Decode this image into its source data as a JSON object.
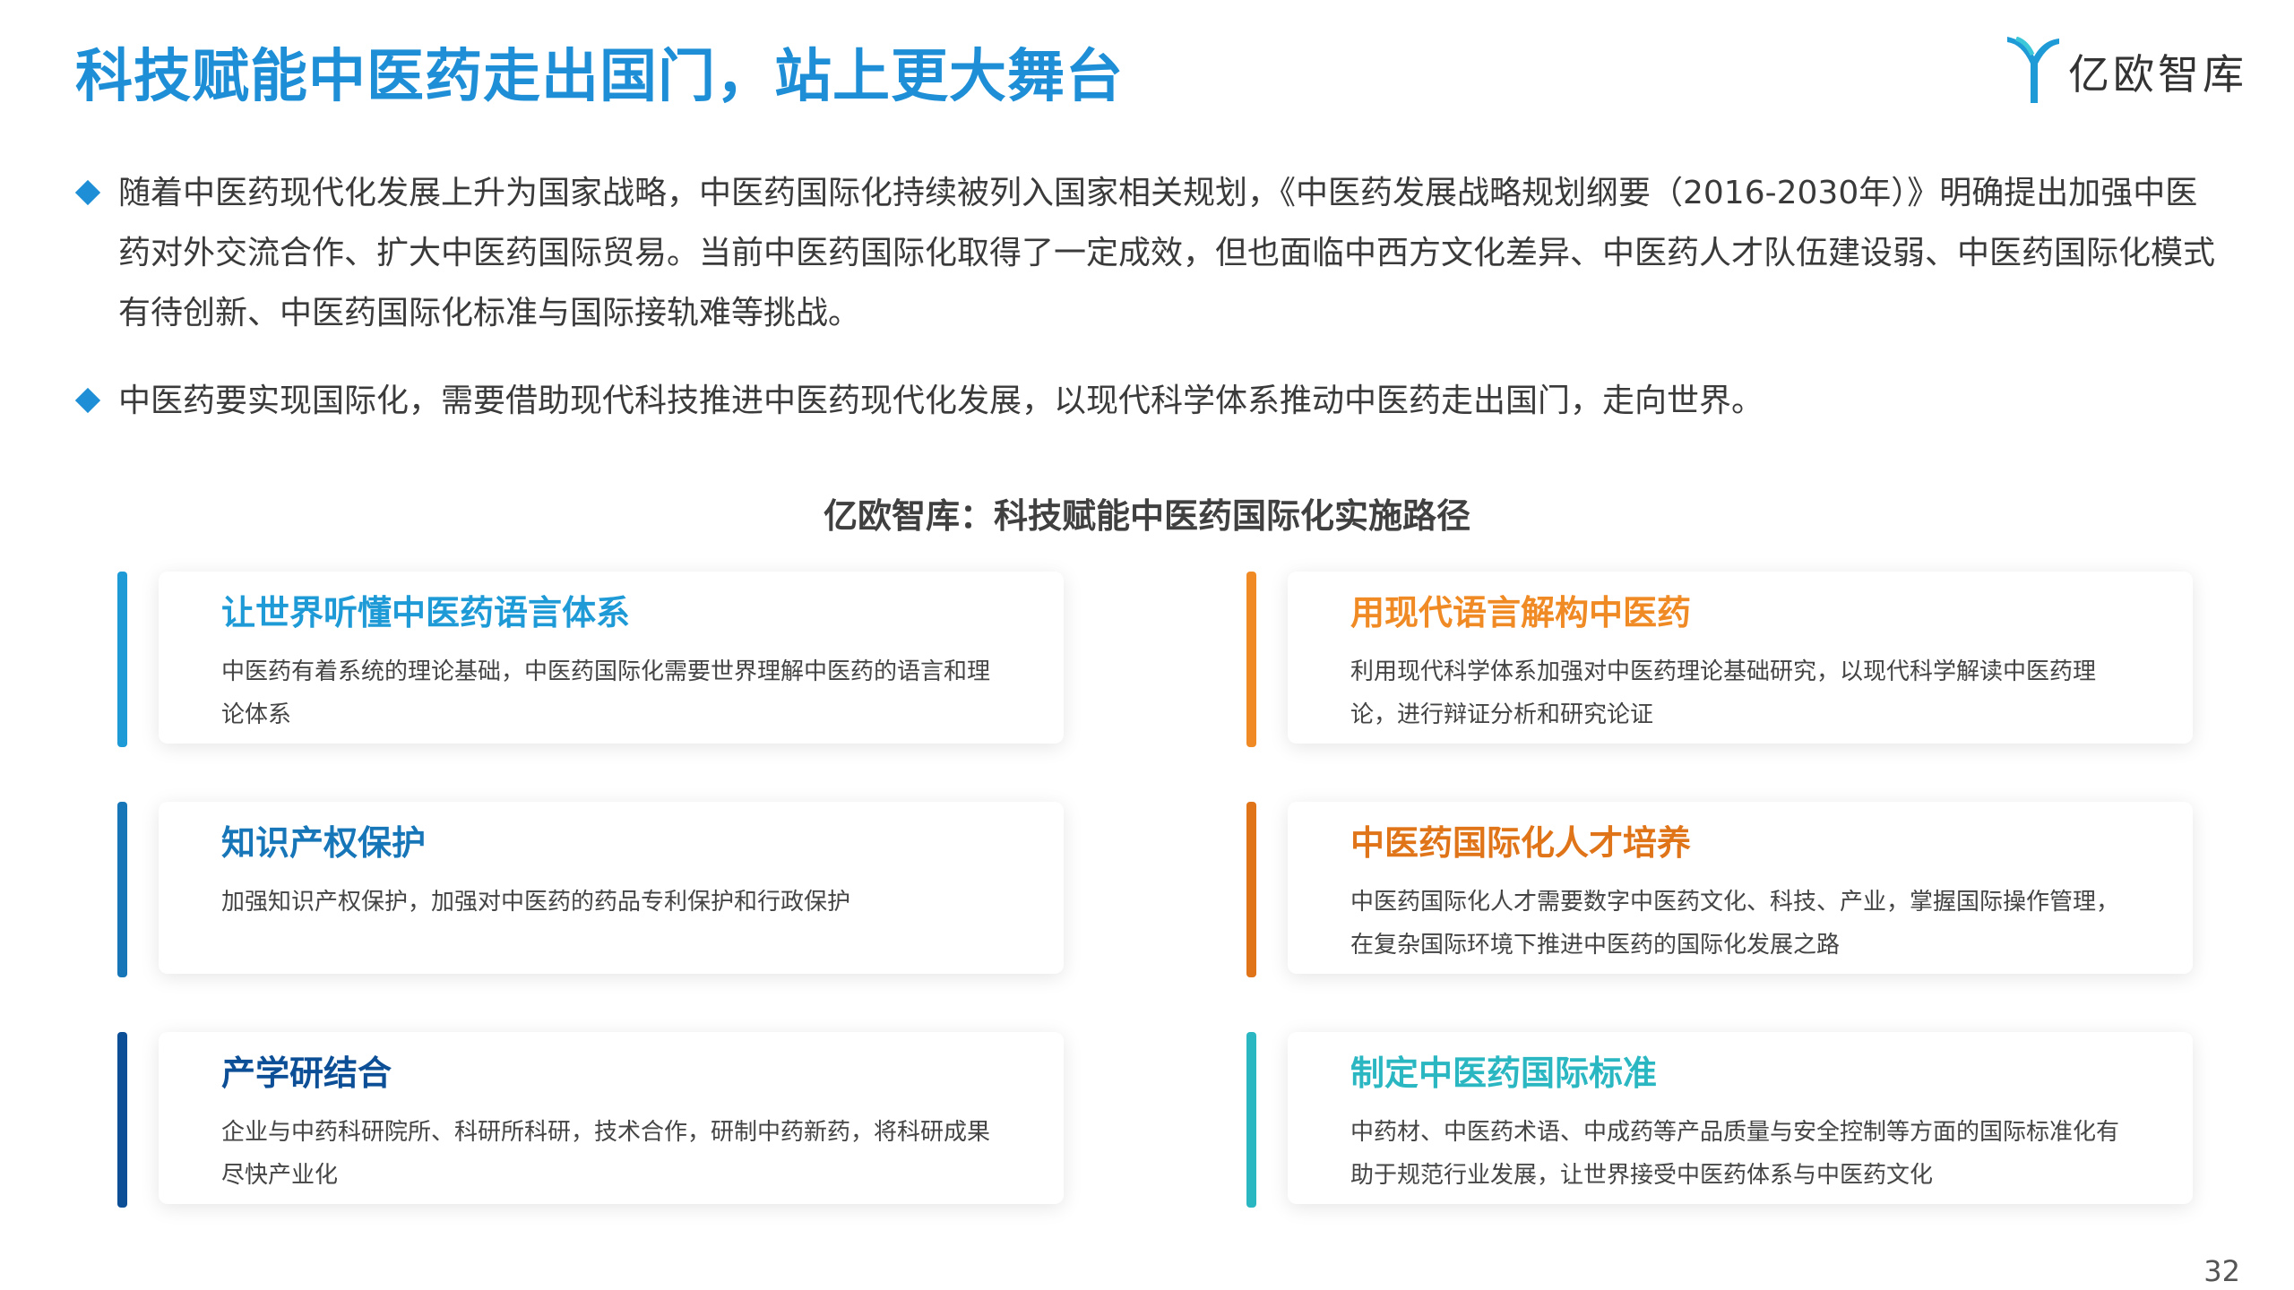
{
  "header": {
    "title": "科技赋能中医药走出国门，站上更大舞台",
    "logo_text": "亿欧智库",
    "logo_icon": "yiou-logo-icon"
  },
  "bullets": [
    {
      "text": "随着中医药现代化发展上升为国家战略，中医药国际化持续被列入国家相关规划，《中医药发展战略规划纲要（2016-2030年）》明确提出加强中医药对外交流合作、扩大中医药国际贸易。当前中医药国际化取得了一定成效，但也面临中西方文化差异、中医药人才队伍建设弱、中医药国际化模式有待创新、中医药国际化标准与国际接轨难等挑战。"
    },
    {
      "text": "中医药要实现国际化，需要借助现代科技推进中医药现代化发展，以现代科学体系推动中医药走出国门，走向世界。"
    }
  ],
  "diagram": {
    "subtitle": "亿欧智库：科技赋能中医药国际化实施路径",
    "cards": [
      {
        "title": "让世界听懂中医药语言体系",
        "desc": "中医药有着系统的理论基础，中医药国际化需要世界理解中医药的语言和理论体系",
        "color": "#1e9ad6"
      },
      {
        "title": "用现代语言解构中医药",
        "desc": "利用现代科学体系加强对中医药理论基础研究，以现代科学解读中医药理论，进行辩证分析和研究论证",
        "color": "#f08a24"
      },
      {
        "title": "知识产权保护",
        "desc": "加强知识产权保护，加强对中医药的药品专利保护和行政保护",
        "color": "#1776b8"
      },
      {
        "title": "中医药国际化人才培养",
        "desc": "中医药国际化人才需要数字中医药文化、科技、产业，掌握国际操作管理，在复杂国际环境下推进中医药的国际化发展之路",
        "color": "#e07418"
      },
      {
        "title": "产学研结合",
        "desc": "企业与中药科研院所、科研所科研，技术合作，研制中药新药，将科研成果尽快产业化",
        "color": "#0d4f96"
      },
      {
        "title": "制定中医药国际标准",
        "desc": "中药材、中医药术语、中成药等产品质量与安全控制等方面的国际标准化有助于规范行业发展，让世界接受中医药体系与中医药文化",
        "color": "#2ab7c2"
      }
    ]
  },
  "colors": {
    "accent": "#1e8fd6"
  },
  "page_number": "32"
}
